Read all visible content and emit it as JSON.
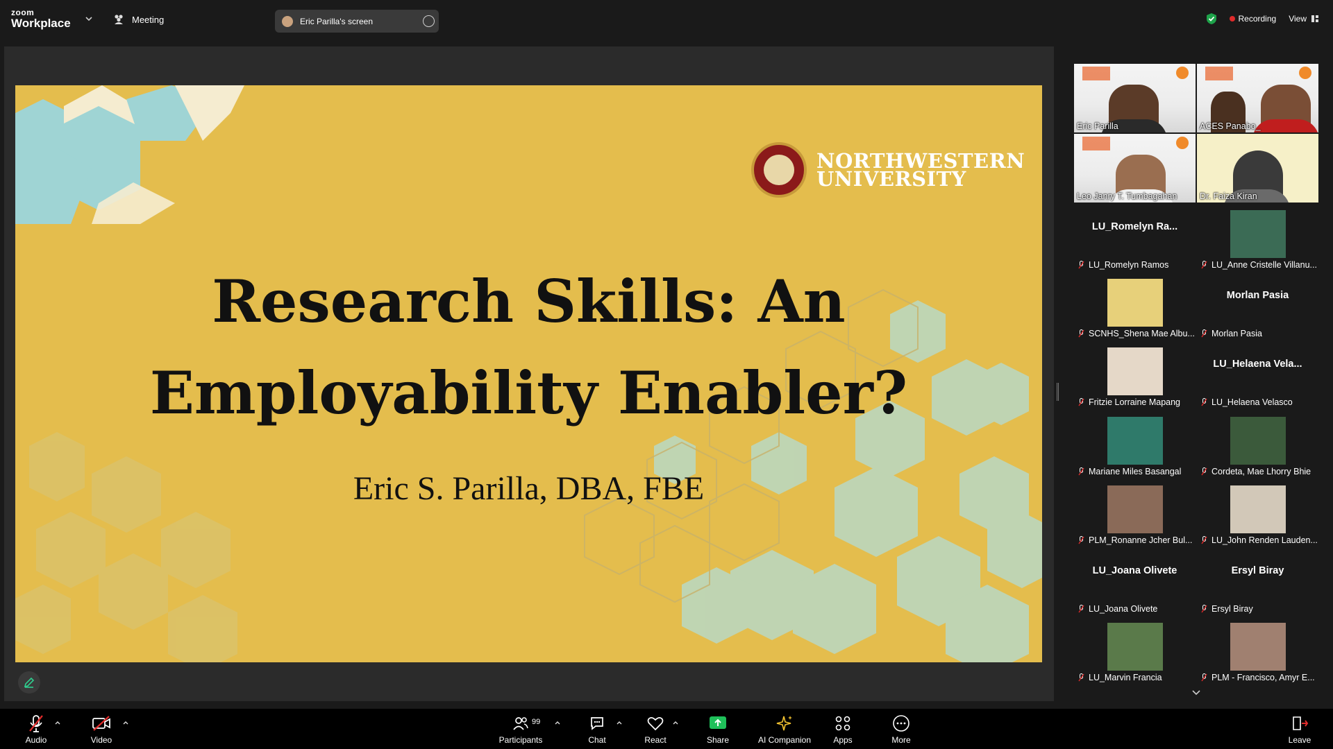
{
  "app": {
    "brand_small": "zoom",
    "brand_large": "Workplace",
    "meeting_label": "Meeting",
    "screen_share_label": "Eric Parilla's screen",
    "recording_label": "Recording",
    "view_label": "View"
  },
  "slide": {
    "logo_line1": "NORTHWESTERN",
    "logo_line2": "UNIVERSITY",
    "title_line1": "Research Skills: An",
    "title_line2": "Employability Enabler?",
    "author": "Eric S. Parilla, DBA, FBE",
    "colors": {
      "background": "#e4bd4d",
      "hex_teal": "#9fd4d4",
      "hex_cream": "#f5ecd0"
    }
  },
  "video_tiles": [
    {
      "name": "Eric Parilla",
      "active": true
    },
    {
      "name": "ACES Panabo_"
    },
    {
      "name": "Leo Janry T. Tumbagahan"
    },
    {
      "name": "Dr. Faiza Kiran"
    }
  ],
  "participants": [
    {
      "display": "LU_Romelyn Ra...",
      "label": "LU_Romelyn Ramos",
      "type": "name"
    },
    {
      "display": "",
      "label": "LU_Anne Cristelle Villanu...",
      "type": "photo"
    },
    {
      "display": "",
      "label": "SCNHS_Shena Mae Albu...",
      "type": "photo"
    },
    {
      "display": "Morlan Pasia",
      "label": "Morlan Pasia",
      "type": "name"
    },
    {
      "display": "",
      "label": "Fritzie Lorraine Mapang",
      "type": "photo"
    },
    {
      "display": "LU_Helaena  Vela...",
      "label": "LU_Helaena Velasco",
      "type": "name"
    },
    {
      "display": "",
      "label": "Mariane Miles Basangal",
      "type": "photo"
    },
    {
      "display": "",
      "label": "Cordeta, Mae Lhorry Bhie",
      "type": "photo"
    },
    {
      "display": "",
      "label": "PLM_Ronanne Jcher Bul...",
      "type": "photo"
    },
    {
      "display": "",
      "label": "LU_John Renden Lauden...",
      "type": "photo"
    },
    {
      "display": "LU_Joana Olivete",
      "label": "LU_Joana Olivete",
      "type": "name"
    },
    {
      "display": "Ersyl Biray",
      "label": "Ersyl Biray",
      "type": "name"
    },
    {
      "display": "",
      "label": "LU_Marvin Francia",
      "type": "photo"
    },
    {
      "display": "",
      "label": "PLM - Francisco, Amyr E...",
      "type": "photo"
    }
  ],
  "toolbar": {
    "audio": "Audio",
    "video": "Video",
    "participants": "Participants",
    "participants_count": "99",
    "chat": "Chat",
    "react": "React",
    "share": "Share",
    "ai": "AI Companion",
    "apps": "Apps",
    "more": "More",
    "leave": "Leave"
  }
}
